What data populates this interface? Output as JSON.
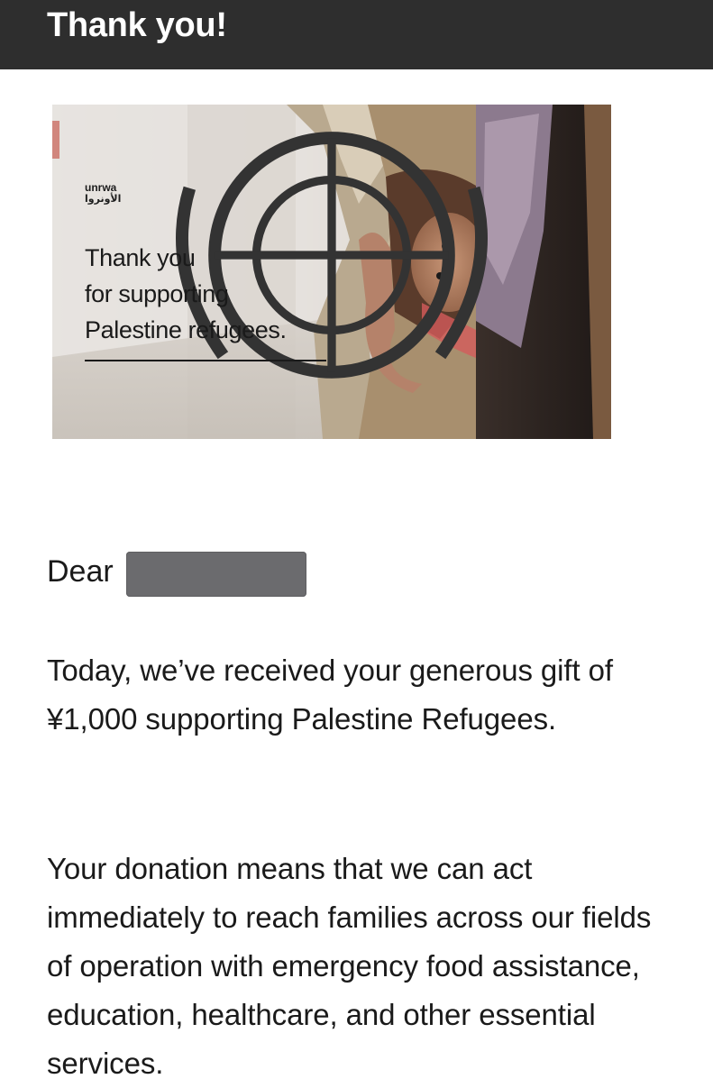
{
  "header": {
    "title": "Thank you!"
  },
  "banner": {
    "logo_wordmark_en": "unrwa",
    "logo_wordmark_ar": "الأونروا",
    "message_line1": "Thank you",
    "message_line2": "for supporting",
    "message_line3": "Palestine refugees."
  },
  "letter": {
    "greeting": "Dear",
    "paragraph1": "Today, we’ve received your generous gift of ¥1,000 supporting Palestine Refugees.",
    "paragraph2": "Your donation means that we can act immediately to reach families across our fields of operation with emergency food assistance, education, healthcare, and other essential services."
  },
  "colors": {
    "header_bg": "#2e2e2e",
    "redaction": "#6b6b6e"
  }
}
